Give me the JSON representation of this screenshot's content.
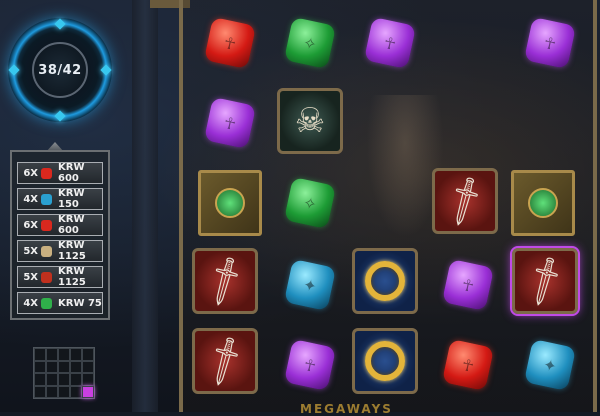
{
  "counter": {
    "text": "38/42"
  },
  "paytable": {
    "rows": [
      {
        "mult": "6X",
        "payout": "KRW 600",
        "color": "#d9281e"
      },
      {
        "mult": "4X",
        "payout": "KRW 150",
        "color": "#2aa0d0"
      },
      {
        "mult": "6X",
        "payout": "KRW 600",
        "color": "#d9281e"
      },
      {
        "mult": "5X",
        "payout": "KRW 1125",
        "color": "#c9b080"
      },
      {
        "mult": "5X",
        "payout": "KRW 1125",
        "color": "#c0301e"
      },
      {
        "mult": "4X",
        "payout": "KRW 75",
        "color": "#2fb04a"
      }
    ]
  },
  "minimap": {
    "cols": 5,
    "rows": 4,
    "active_index": 19
  },
  "grid": {
    "symbols": [
      [
        "red-gem",
        "green-gem",
        "purple-gem",
        "",
        "purple-gem"
      ],
      [
        "purple-gem",
        "skull-mask",
        "",
        "",
        ""
      ],
      [
        "spellbook",
        "green-gem",
        "",
        "dagger",
        "spellbook"
      ],
      [
        "dagger",
        "blue-gem",
        "gold-ring",
        "purple-gem",
        "dagger"
      ],
      [
        "dagger",
        "purple-gem",
        "gold-ring",
        "red-gem",
        "blue-gem"
      ]
    ]
  },
  "bottom_text": "MEGAWAYS"
}
